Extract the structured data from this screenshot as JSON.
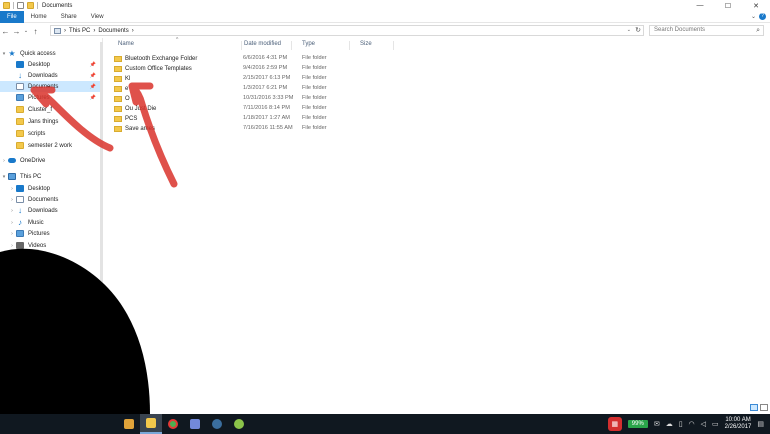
{
  "window": {
    "title": "Documents",
    "controls": {
      "minimize": "—",
      "maximize": "☐",
      "close": "✕"
    }
  },
  "ribbon": {
    "tabs": [
      "File",
      "Home",
      "Share",
      "View"
    ],
    "collapse": "⌄",
    "help": "?"
  },
  "address": {
    "crumbs": [
      "This PC",
      "Documents"
    ],
    "sep": "›",
    "search_placeholder": "Search Documents",
    "nav": {
      "back": "←",
      "forward": "→",
      "recent": "⌄",
      "up": "↑",
      "dropdown": "⌄",
      "refresh": "↻",
      "search_icon": "⌕"
    }
  },
  "sidebar": {
    "quick_access": "Quick access",
    "quick_items": [
      {
        "label": "Desktop",
        "icon": "desktop-icon",
        "pinned": true
      },
      {
        "label": "Downloads",
        "icon": "download-icon",
        "pinned": true
      },
      {
        "label": "Documents",
        "icon": "documents-icon",
        "pinned": true,
        "selected": true
      },
      {
        "label": "Pictures",
        "icon": "pictures-icon",
        "pinned": true
      },
      {
        "label": "Cluster_f",
        "icon": "folder-icon"
      },
      {
        "label": "Jans things",
        "icon": "folder-icon"
      },
      {
        "label": "scripts",
        "icon": "folder-icon"
      },
      {
        "label": "semester 2 work",
        "icon": "folder-icon"
      }
    ],
    "onedrive": "OneDrive",
    "this_pc": "This PC",
    "pc_items": [
      {
        "label": "Desktop",
        "icon": "desktop-icon"
      },
      {
        "label": "Documents",
        "icon": "documents-icon"
      },
      {
        "label": "Downloads",
        "icon": "download-icon"
      },
      {
        "label": "Music",
        "icon": "music-icon"
      },
      {
        "label": "Pictures",
        "icon": "pictures-icon"
      },
      {
        "label": "Videos",
        "icon": "videos-icon"
      }
    ],
    "pin_glyph": "📌"
  },
  "columns": {
    "name": "Name",
    "date": "Date modified",
    "type": "Type",
    "size": "Size",
    "sort_glyph": "^"
  },
  "files": [
    {
      "name": "Bluetooth Exchange Folder",
      "date": "6/6/2016 4:31 PM",
      "type": "File folder"
    },
    {
      "name": "Custom Office Templates",
      "date": "9/4/2016 2:59 PM",
      "type": "File folder"
    },
    {
      "name": "Kl",
      "date": "2/15/2017 6:13 PM",
      "type": "File folder"
    },
    {
      "name": "e",
      "date": "1/3/2017 6:21 PM",
      "type": "File folder"
    },
    {
      "name": "O",
      "date": "10/31/2016 3:33 PM",
      "type": "File folder"
    },
    {
      "name": "Ou  Just Die",
      "date": "7/11/2016 8:14 PM",
      "type": "File folder"
    },
    {
      "name": "PCS",
      "date": "1/18/2017 1:27 AM",
      "type": "File folder"
    },
    {
      "name": "Save  ames",
      "date": "7/16/2016 11:55 AM",
      "type": "File folder"
    }
  ],
  "taskbar": {
    "apps": [
      {
        "icon": "media-player-icon",
        "color": "#e0a33a"
      },
      {
        "icon": "file-explorer-icon",
        "color": "#f3c84b",
        "active": true
      },
      {
        "icon": "chrome-icon",
        "color": "#4caf50"
      },
      {
        "icon": "discord-icon",
        "color": "#7289da"
      },
      {
        "icon": "steam-icon",
        "color": "#3b6e9e"
      },
      {
        "icon": "app-icon",
        "color": "#8bc34a"
      }
    ],
    "battery": "99%",
    "time": "10:00 AM",
    "date": "2/26/2017"
  },
  "colors": {
    "accent": "#1979ca",
    "selection": "#cce8ff",
    "annotation": "#d9322b"
  }
}
